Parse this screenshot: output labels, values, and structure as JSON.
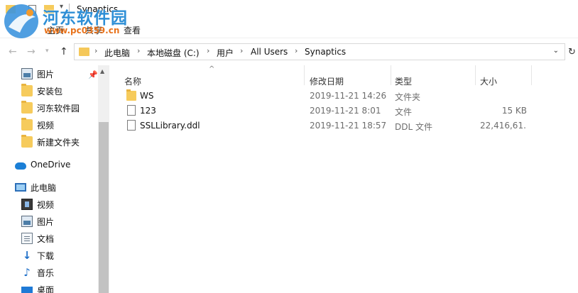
{
  "window": {
    "title": "Synaptics",
    "watermark_title": "河东软件园",
    "watermark_url": "www.pc0359.cn"
  },
  "ribbon": {
    "tabs": [
      "主页",
      "共享",
      "查看"
    ]
  },
  "address": {
    "crumbs": [
      "此电脑",
      "本地磁盘 (C:)",
      "用户",
      "All Users",
      "Synaptics"
    ]
  },
  "nav_pane": {
    "quick_access": [
      {
        "label": "图片",
        "icon": "pictures-icon"
      },
      {
        "label": "安装包",
        "icon": "folder-icon"
      },
      {
        "label": "河东软件园",
        "icon": "folder-icon"
      },
      {
        "label": "视频",
        "icon": "folder-icon"
      },
      {
        "label": "新建文件夹",
        "icon": "folder-icon"
      }
    ],
    "onedrive": "OneDrive",
    "this_pc": "此电脑",
    "pc_items": [
      {
        "label": "视频",
        "icon": "videos-icon"
      },
      {
        "label": "图片",
        "icon": "pictures-icon"
      },
      {
        "label": "文档",
        "icon": "documents-icon"
      },
      {
        "label": "下载",
        "icon": "downloads-icon"
      },
      {
        "label": "音乐",
        "icon": "music-icon"
      },
      {
        "label": "桌面",
        "icon": "desktop-icon"
      }
    ]
  },
  "file_list": {
    "columns": {
      "name": "名称",
      "modified": "修改日期",
      "type": "类型",
      "size": "大小"
    },
    "rows": [
      {
        "name": "WS",
        "modified": "2019-11-21 14:26",
        "type": "文件夹",
        "size": "",
        "icon": "folder-icon"
      },
      {
        "name": "123",
        "modified": "2019-11-21 8:01",
        "type": "文件",
        "size": "15 KB",
        "icon": "file-icon"
      },
      {
        "name": "SSLLibrary.ddl",
        "modified": "2019-11-21 18:57",
        "type": "DDL 文件",
        "size": "22,416,61...",
        "icon": "file-icon"
      }
    ]
  }
}
